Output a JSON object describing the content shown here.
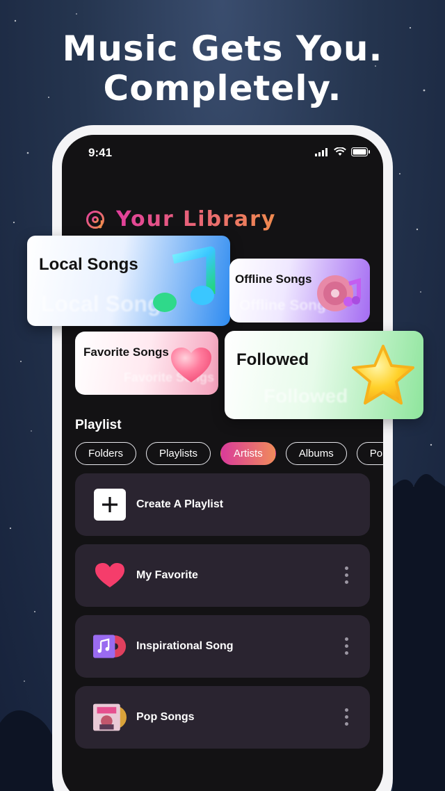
{
  "hero": {
    "line1": "Music Gets You.",
    "line2": "Completely."
  },
  "status_bar": {
    "time": "9:41"
  },
  "library": {
    "title": "Your Library",
    "cards": {
      "local": "Local Songs",
      "offline": "Offline Songs",
      "favorite": "Favorite Songs",
      "followed": "Followed"
    }
  },
  "playlist": {
    "heading": "Playlist",
    "chips": [
      "Folders",
      "Playlists",
      "Artists",
      "Albums",
      "Po"
    ],
    "active_chip": "Artists",
    "rows": [
      {
        "label": "Create A Playlist",
        "icon": "plus-icon"
      },
      {
        "label": "My Favorite",
        "icon": "heart-icon"
      },
      {
        "label": "Inspirational Song",
        "icon": "music-album-icon"
      },
      {
        "label": "Pop Songs",
        "icon": "album-cover-icon"
      }
    ]
  },
  "colors": {
    "accent_start": "#d93b9a",
    "accent_end": "#f08b5b",
    "row_bg": "#2a2430",
    "screen_bg": "#131214"
  }
}
